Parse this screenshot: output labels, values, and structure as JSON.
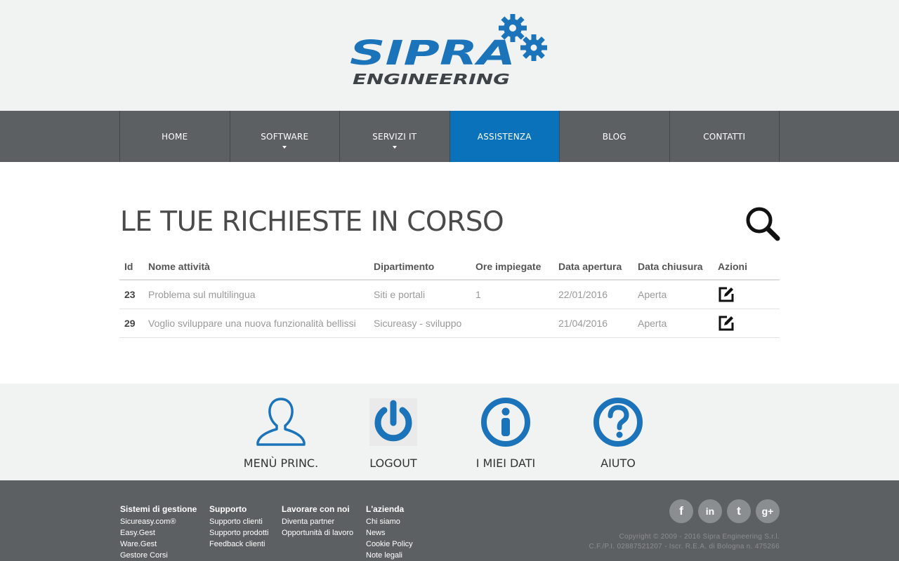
{
  "brand": {
    "name": "SIPRA",
    "sub": "ENGINEERING",
    "primary_color": "#1b74ba",
    "dark_color": "#3d4347"
  },
  "nav": {
    "items": [
      {
        "label": "HOME",
        "has_dropdown": false,
        "active": false
      },
      {
        "label": "SOFTWARE",
        "has_dropdown": true,
        "active": false
      },
      {
        "label": "SERVIZI IT",
        "has_dropdown": true,
        "active": false
      },
      {
        "label": "ASSISTENZA",
        "has_dropdown": false,
        "active": true
      },
      {
        "label": "BLOG",
        "has_dropdown": false,
        "active": false
      },
      {
        "label": "CONTATTI",
        "has_dropdown": false,
        "active": false
      }
    ],
    "active_color": "#0a72bb"
  },
  "main": {
    "title": "LE TUE RICHIESTE IN CORSO",
    "search_icon": "search-icon",
    "table": {
      "headers": [
        "Id",
        "Nome attività",
        "Dipartimento",
        "Ore impiegate",
        "Data apertura",
        "Data chiusura",
        "Azioni"
      ],
      "rows": [
        {
          "id": "23",
          "name": "Problema sul multilingua",
          "department": "Siti e portali",
          "hours": "1",
          "opened": "22/01/2016",
          "closed": "Aperta",
          "action_icon": "edit-icon"
        },
        {
          "id": "29",
          "name": "Voglio sviluppare una nuova funzionalità bellissi",
          "department": "Sicureasy - sviluppo",
          "hours": "",
          "opened": "21/04/2016",
          "closed": "Aperta",
          "action_icon": "edit-icon"
        }
      ]
    }
  },
  "quick_actions": [
    {
      "label": "MENÙ PRINC.",
      "icon": "user-icon"
    },
    {
      "label": "LOGOUT",
      "icon": "power-icon"
    },
    {
      "label": "I MIEI DATI",
      "icon": "info-icon"
    },
    {
      "label": "AIUTO",
      "icon": "help-icon"
    }
  ],
  "footer": {
    "columns": [
      {
        "title": "Sistemi di gestione",
        "links": [
          "Sicureasy.com®",
          "Easy.Gest",
          "Ware.Gest",
          "Gestore Corsi"
        ]
      },
      {
        "title": "Supporto",
        "links": [
          "Supporto clienti",
          "Supporto prodotti",
          "Feedback clienti"
        ]
      },
      {
        "title": "Lavorare con noi",
        "links": [
          "Diventa partner",
          "Opportunità di lavoro"
        ]
      },
      {
        "title": "L'azienda",
        "links": [
          "Chi siamo",
          "News",
          "Cookie Policy",
          "Note legali"
        ]
      }
    ],
    "social": [
      {
        "icon": "facebook-icon",
        "glyph": "f"
      },
      {
        "icon": "linkedin-icon",
        "glyph": "in"
      },
      {
        "icon": "twitter-icon",
        "glyph": "t"
      },
      {
        "icon": "google-plus-icon",
        "glyph": "g+"
      }
    ],
    "copyright": "Copyright © 2009 - 2016 Sipra Engineering S.r.l.",
    "vat": "C.F./P.I. 02887521207 - Iscr. R.E.A. di Bologna n. 475266"
  }
}
